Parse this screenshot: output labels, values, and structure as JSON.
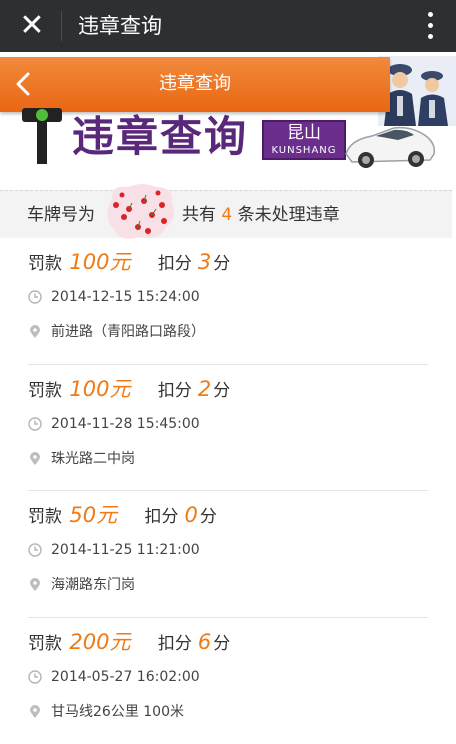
{
  "titlebar": {
    "close_icon": "close-icon",
    "title": "违章查询",
    "more_icon": "more-vertical-icon"
  },
  "header": {
    "back_icon": "chevron-left-icon",
    "title": "违章查询"
  },
  "banner": {
    "logo_text": "违章查询",
    "region_cn": "昆山",
    "region_en": "KUNSHANG",
    "colors": {
      "orange": "#e96712",
      "purple": "#6b2e8c"
    }
  },
  "summary": {
    "prefix": "车牌号为",
    "count_prefix": "共有",
    "count": "4",
    "count_suffix": "条未处理违章"
  },
  "labels": {
    "fine": "罚款",
    "points": "扣分",
    "points_unit": "分"
  },
  "violations": [
    {
      "fine": "100元",
      "points": "3",
      "time": "2014-12-15 15:24:00",
      "location": "前进路（青阳路口路段）"
    },
    {
      "fine": "100元",
      "points": "2",
      "time": "2014-11-28 15:45:00",
      "location": "珠光路二中岗"
    },
    {
      "fine": "50元",
      "points": "0",
      "time": "2014-11-25 11:21:00",
      "location": "海潮路东门岗"
    },
    {
      "fine": "200元",
      "points": "6",
      "time": "2014-05-27 16:02:00",
      "location": "甘马线26公里 100米"
    }
  ]
}
